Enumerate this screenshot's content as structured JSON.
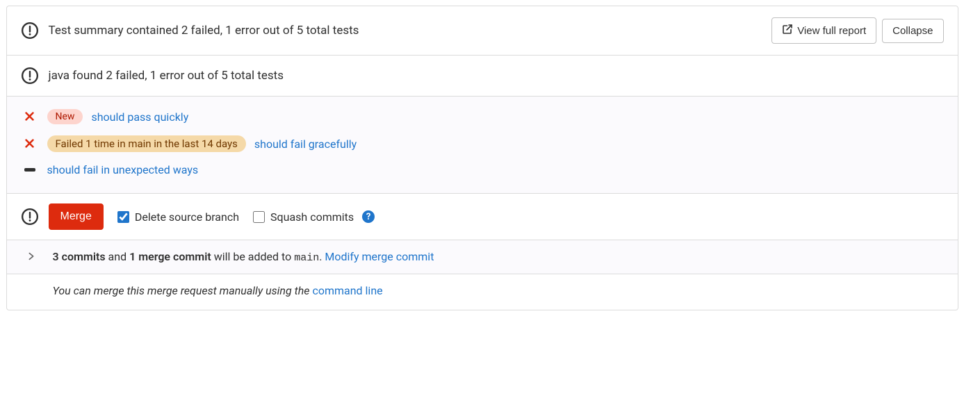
{
  "header": {
    "summary": "Test summary contained 2 failed, 1 error out of 5 total tests",
    "view_full_label": "View full report",
    "collapse_label": "Collapse"
  },
  "java_section": {
    "summary": "java found 2 failed, 1 error out of 5 total tests"
  },
  "tests": [
    {
      "status": "fail",
      "badge_type": "new",
      "badge_label": "New",
      "name": "should pass quickly"
    },
    {
      "status": "fail",
      "badge_type": "flaky",
      "badge_label": "Failed 1 time in main in the last 14 days",
      "name": "should fail gracefully"
    },
    {
      "status": "error",
      "badge_type": null,
      "badge_label": null,
      "name": "should fail in unexpected ways"
    }
  ],
  "merge": {
    "button_label": "Merge",
    "delete_branch_label": "Delete source branch",
    "delete_branch_checked": true,
    "squash_label": "Squash commits",
    "squash_checked": false
  },
  "commits": {
    "count_commits": "3 commits",
    "and": " and ",
    "merge_commit": "1 merge commit",
    "tail": " will be added to ",
    "branch": "main",
    "period": ". ",
    "modify_link": "Modify merge commit"
  },
  "manual": {
    "text": "You can merge this merge request manually using the ",
    "link": "command line"
  }
}
